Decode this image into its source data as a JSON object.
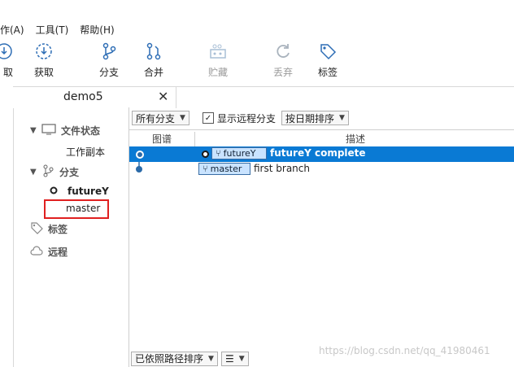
{
  "menu": [
    "作(A)",
    "工具(T)",
    "帮助(H)"
  ],
  "toolbar": {
    "items": [
      {
        "label": "取",
        "icon": "fetch-icon",
        "disabled": false
      },
      {
        "label": "获取",
        "icon": "pull-icon",
        "disabled": false
      },
      {
        "label": "分支",
        "icon": "branch-icon",
        "disabled": false
      },
      {
        "label": "合并",
        "icon": "merge-icon",
        "disabled": false
      },
      {
        "label": "贮藏",
        "icon": "stash-icon",
        "disabled": true
      },
      {
        "label": "丢弃",
        "icon": "discard-icon",
        "disabled": true
      },
      {
        "label": "标签",
        "icon": "tag-icon",
        "disabled": false
      }
    ]
  },
  "tab": {
    "title": "demo5",
    "close": "✕"
  },
  "sidebar": {
    "file_status": "文件状态",
    "working_copy": "工作副本",
    "branches": "分支",
    "branch_current": "futureY",
    "branch_other": "master",
    "tags": "标签",
    "remotes": "远程"
  },
  "filters": {
    "all_branches": "所有分支",
    "show_remote": "显示远程分支",
    "sort_by_date": "按日期排序"
  },
  "columns": {
    "graph": "图谱",
    "description": "描述"
  },
  "commits": [
    {
      "branch": "futureY",
      "message": "futureY complete",
      "selected": true
    },
    {
      "branch": "master",
      "message": "first branch",
      "selected": false
    }
  ],
  "bottom": {
    "sort_path": "已依照路径排序"
  },
  "watermark": "https://blog.csdn.net/qq_41980461",
  "colors": {
    "selection": "#0a7ad4",
    "highlight_box": "#e02020",
    "tag_bg": "#c9e3ff"
  }
}
